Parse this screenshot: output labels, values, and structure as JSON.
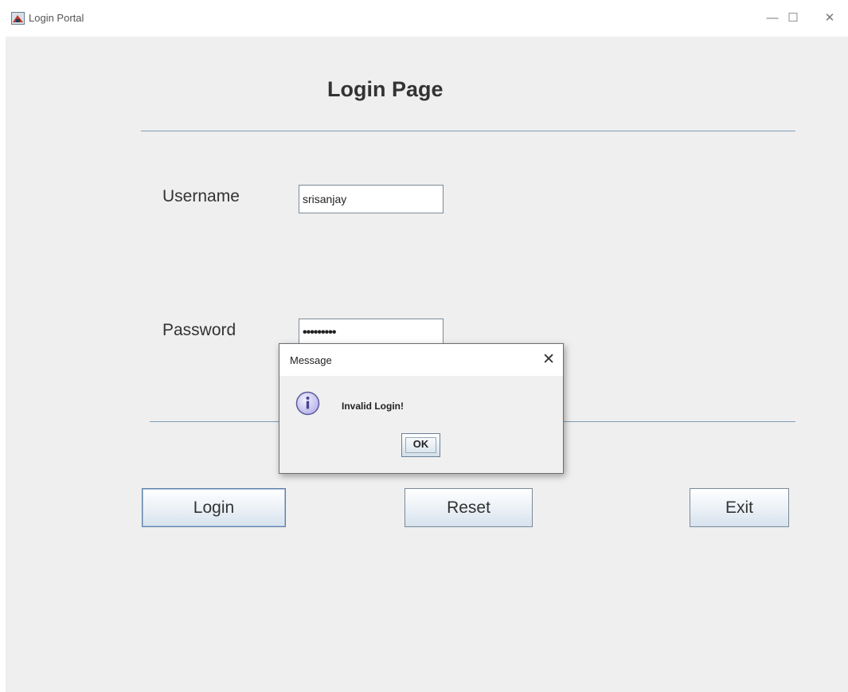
{
  "window": {
    "title": "Login Portal",
    "minimize_glyph": "—",
    "maximize_glyph": "☐",
    "close_glyph": "✕"
  },
  "page": {
    "title": "Login Page"
  },
  "form": {
    "username_label": "Username",
    "username_value": "srisanjay",
    "password_label": "Password",
    "password_value": "•••••••••"
  },
  "buttons": {
    "login": "Login",
    "reset": "Reset",
    "exit": "Exit"
  },
  "dialog": {
    "title": "Message",
    "close_glyph": "✕",
    "message": "Invalid Login!",
    "ok": "OK",
    "icon": "info-icon"
  },
  "colors": {
    "separator": "#7f9db9",
    "info_icon_fill": "#c9c6f0",
    "info_icon_stroke": "#5f5a9e"
  }
}
